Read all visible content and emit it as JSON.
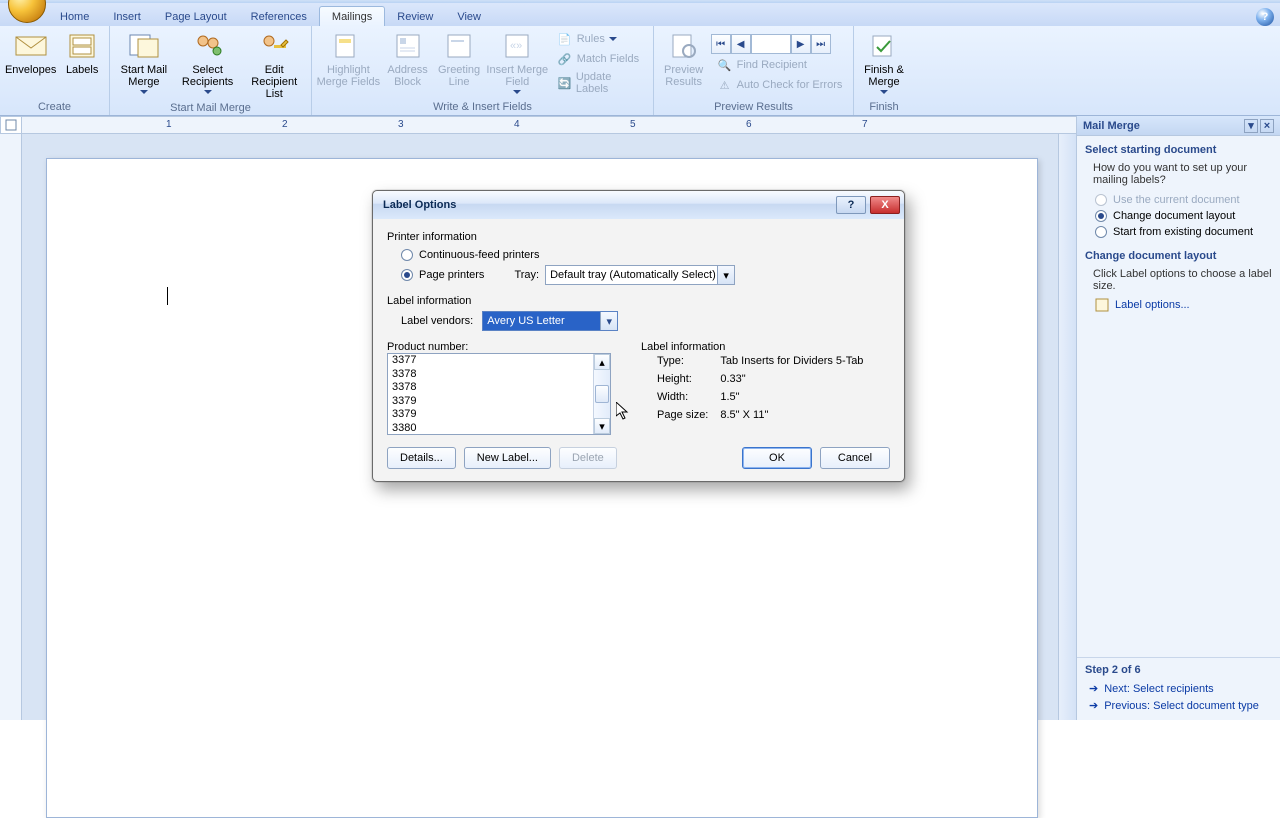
{
  "tabs": [
    "Home",
    "Insert",
    "Page Layout",
    "References",
    "Mailings",
    "Review",
    "View"
  ],
  "active_tab": "Mailings",
  "ribbon": {
    "create": {
      "label": "Create",
      "envelopes": "Envelopes",
      "labels": "Labels"
    },
    "startmm": {
      "label": "Start Mail Merge",
      "start": "Start Mail\nMerge",
      "select": "Select\nRecipients",
      "edit": "Edit\nRecipient List"
    },
    "write": {
      "label": "Write & Insert Fields",
      "highlight": "Highlight\nMerge Fields",
      "address": "Address\nBlock",
      "greeting": "Greeting\nLine",
      "insertmf": "Insert Merge\nField",
      "rules": "Rules",
      "match": "Match Fields",
      "update": "Update Labels"
    },
    "preview": {
      "label": "Preview Results",
      "previewbtn": "Preview\nResults",
      "find": "Find Recipient",
      "auto": "Auto Check for Errors"
    },
    "finish": {
      "label": "Finish",
      "finishbtn": "Finish &\nMerge"
    }
  },
  "pane": {
    "title": "Mail Merge",
    "sec1": "Select starting document",
    "q": "How do you want to set up your mailing labels?",
    "opt1": "Use the current document",
    "opt2": "Change document layout",
    "opt2_selected": true,
    "opt3": "Start from existing document",
    "sec2": "Change document layout",
    "desc2": "Click Label options to choose a label size.",
    "link": "Label options...",
    "step": "Step 2 of 6",
    "next": "Next: Select recipients",
    "prev": "Previous: Select document type"
  },
  "dialog": {
    "title": "Label Options",
    "printer_info": "Printer information",
    "cfp": "Continuous-feed printers",
    "pp": "Page printers",
    "pp_selected": true,
    "tray_lbl": "Tray:",
    "tray_val": "Default tray (Automatically Select)",
    "labelinfo": "Label information",
    "vendors_lbl": "Label vendors:",
    "vendor_val": "Avery US Letter",
    "productnum": "Product number:",
    "products": [
      "3377",
      "3378",
      "3378",
      "3379",
      "3379",
      "3380"
    ],
    "rightheader": "Label information",
    "type_lbl": "Type:",
    "type_val": "Tab Inserts for Dividers 5-Tab",
    "height_lbl": "Height:",
    "height_val": "0.33\"",
    "width_lbl": "Width:",
    "width_val": "1.5\"",
    "pagesize_lbl": "Page size:",
    "pagesize_val": "8.5\" X 11\"",
    "details": "Details...",
    "newlabel": "New Label...",
    "delete": "Delete",
    "ok": "OK",
    "cancel": "Cancel"
  },
  "ruler_numbers": [
    "1",
    "2",
    "3",
    "4",
    "5",
    "6",
    "7"
  ]
}
